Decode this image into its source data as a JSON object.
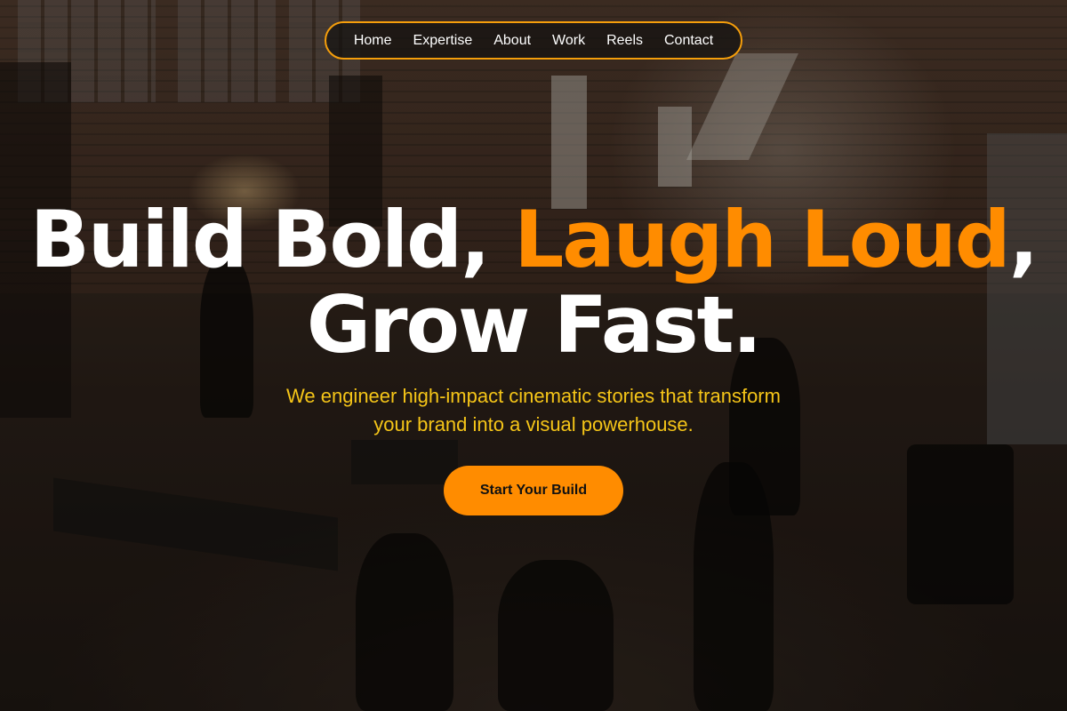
{
  "nav": {
    "items": [
      {
        "label": "Home"
      },
      {
        "label": "Expertise"
      },
      {
        "label": "About"
      },
      {
        "label": "Work"
      },
      {
        "label": "Reels"
      },
      {
        "label": "Contact"
      }
    ]
  },
  "hero": {
    "line1_part1": "Build Bold, ",
    "line1_accent": "Laugh Loud",
    "line1_part2": ",",
    "line2": "Grow Fast.",
    "subtitle_line1": "We engineer high-impact cinematic stories that transform",
    "subtitle_line2": "your brand into a visual powerhouse.",
    "cta_label": "Start Your Build"
  },
  "colors": {
    "accent": "#ff8c00",
    "subtitle": "#f5c518",
    "nav_border": "#f59e0b"
  }
}
